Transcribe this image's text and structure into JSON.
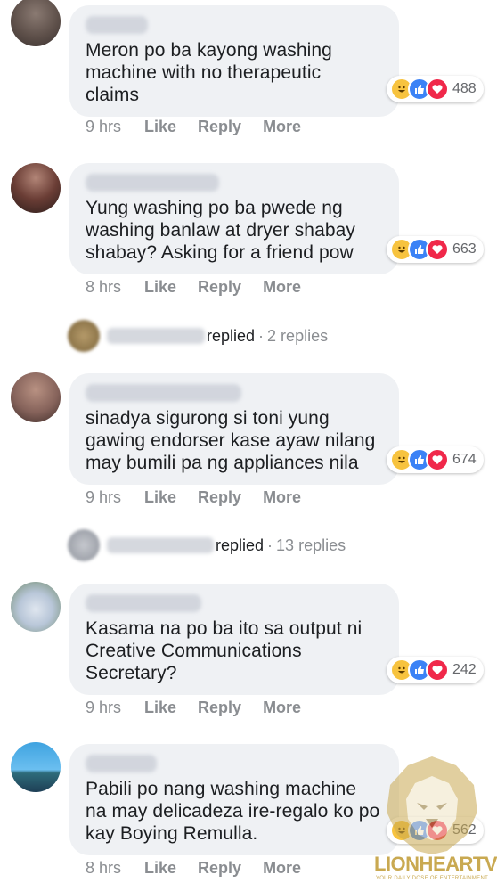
{
  "comments": [
    {
      "text": "Meron po ba kayong washing\nmachine with no therapeutic\nclaims",
      "reactions": "488",
      "time": "9 hrs",
      "actions": [
        "Like",
        "Reply",
        "More"
      ]
    },
    {
      "text": "Yung washing po ba pwede ng\nwashing banlaw at dryer shabay\nshabay? Asking for a friend pow",
      "reactions": "663",
      "time": "8 hrs",
      "actions": [
        "Like",
        "Reply",
        "More"
      ],
      "replies": {
        "replied": "replied",
        "count": "2 replies"
      }
    },
    {
      "text": "sinadya sigurong si toni yung\ngawing endorser kase ayaw nilang\nmay bumili pa ng appliances nila",
      "reactions": "674",
      "time": "9 hrs",
      "actions": [
        "Like",
        "Reply",
        "More"
      ],
      "replies": {
        "replied": "replied",
        "count": "13 replies"
      }
    },
    {
      "text": "Kasama na po ba ito sa output ni\nCreative Communications\nSecretary?",
      "reactions": "242",
      "time": "9 hrs",
      "actions": [
        "Like",
        "Reply",
        "More"
      ]
    },
    {
      "text": "Pabili po nang washing machine\nna may delicadeza ire-regalo ko po\nkay Boying Remulla.",
      "reactions": "562",
      "time": "8 hrs",
      "actions": [
        "Like",
        "Reply",
        "More"
      ]
    }
  ],
  "watermark": {
    "brand": "LIONHEARTV",
    "tagline": "YOUR DAILY DOSE OF ENTERTAINMENT"
  },
  "icons": {
    "reactions": [
      "haha-icon",
      "like-icon",
      "love-icon"
    ]
  },
  "colors": {
    "bubble": "#eff1f4",
    "like": "#3b82f6",
    "love": "#f0284a",
    "haha": "#f7c33f",
    "brand": "#c9a951"
  }
}
